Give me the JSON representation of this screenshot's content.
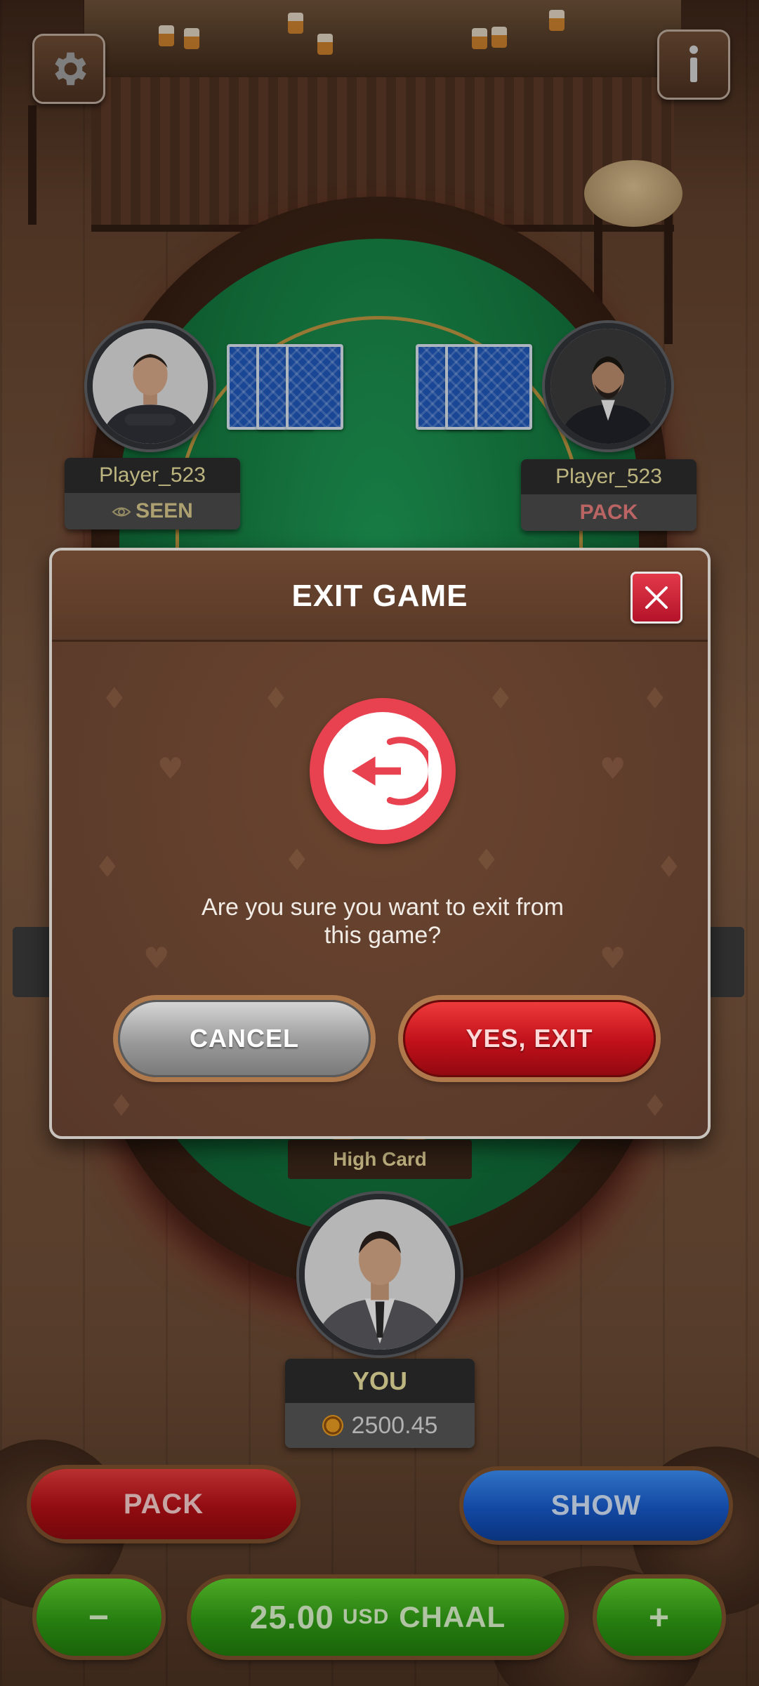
{
  "top_bar": {
    "settings_icon": "gear-icon",
    "info_icon": "info-icon"
  },
  "players": {
    "left": {
      "name": "Player_523",
      "status": "SEEN",
      "status_icon": "eye-icon"
    },
    "right": {
      "name": "Player_523",
      "status": "PACK"
    }
  },
  "hand": {
    "label": "High Card"
  },
  "you": {
    "name": "YOU",
    "balance": "2500.45",
    "chip_icon": "chip-icon"
  },
  "actions": {
    "pack_label": "PACK",
    "show_label": "SHOW",
    "minus_label": "−",
    "plus_label": "+",
    "chaal_amount": "25.00",
    "chaal_currency": "USD",
    "chaal_label": "CHAAL"
  },
  "modal": {
    "title": "EXIT GAME",
    "message_line1": "Are you sure you want to exit from",
    "message_line2": "this game?",
    "cancel_label": "CANCEL",
    "confirm_label": "YES, EXIT",
    "icon": "exit-arrow-icon",
    "close_icon": "close-icon"
  },
  "colors": {
    "felt": "#13743d",
    "modal_bg": "#5e3d2c",
    "danger": "#c0101a",
    "show_blue": "#1758c7",
    "chaal_green": "#2f9a14"
  }
}
